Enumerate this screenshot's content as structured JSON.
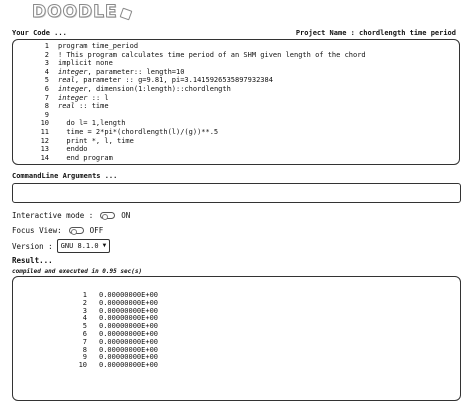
{
  "logo": {
    "text": "DOODLE"
  },
  "editor": {
    "label": "Your Code ...",
    "project_label": "Project Name : chordlength time period",
    "lines": [
      {
        "n": "1",
        "text": "program time_period"
      },
      {
        "n": "2",
        "text": "! This program calculates time period of an SHM given length of the chord"
      },
      {
        "n": "3",
        "text": "implicit none"
      },
      {
        "n": "4",
        "kw": "integer",
        "text": ", parameter:: length=10"
      },
      {
        "n": "5",
        "kw": "real",
        "text": ", parameter :: g=9.81, pi=3.1415926535897932384"
      },
      {
        "n": "6",
        "kw": "integer",
        "text": ", dimension(1:length)::chordlength"
      },
      {
        "n": "7",
        "kw": "integer",
        "text": " :: l"
      },
      {
        "n": "8",
        "kw": "real",
        "text": " :: time"
      },
      {
        "n": "9",
        "text": ""
      },
      {
        "n": "10",
        "text": "  do l= 1,length"
      },
      {
        "n": "11",
        "text": "  time = 2*pi*(chordlength(l)/(g))**.5"
      },
      {
        "n": "12",
        "text": "  print *, l, time"
      },
      {
        "n": "13",
        "text": "  enddo"
      },
      {
        "n": "14",
        "text": "  end program"
      }
    ]
  },
  "cmdline": {
    "label": "CommandLine Arguments ...",
    "value": ""
  },
  "interactive": {
    "label": "Interactive mode :",
    "state": "ON"
  },
  "focus": {
    "label": "Focus View:",
    "state": "OFF"
  },
  "version": {
    "label": "Version :",
    "selected": "GNU 8.1.0"
  },
  "result": {
    "label": "Result...",
    "exec_note": "compiled and executed in 0.95 sec(s)",
    "rows": [
      {
        "i": "1",
        "v": "0.00000000E+00"
      },
      {
        "i": "2",
        "v": "0.00000000E+00"
      },
      {
        "i": "3",
        "v": "0.00000000E+00"
      },
      {
        "i": "4",
        "v": "0.00000000E+00"
      },
      {
        "i": "5",
        "v": "0.00000000E+00"
      },
      {
        "i": "6",
        "v": "0.00000000E+00"
      },
      {
        "i": "7",
        "v": "0.00000000E+00"
      },
      {
        "i": "8",
        "v": "0.00000000E+00"
      },
      {
        "i": "9",
        "v": "0.00000000E+00"
      },
      {
        "i": "10",
        "v": "0.00000000E+00"
      }
    ]
  }
}
